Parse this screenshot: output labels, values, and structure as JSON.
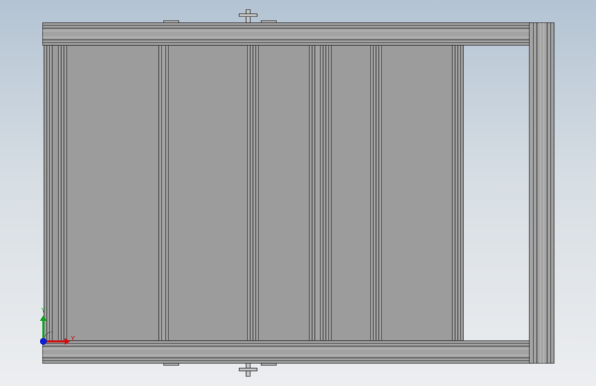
{
  "viewport": {
    "background_top": "#b3c3d3",
    "background_bottom": "#eceef0"
  },
  "model": {
    "panel_fill": "#9c9c9c",
    "frame_fill": "#a2a2a2",
    "edge_color": "#1a1a1a",
    "highlight": "#c9c9c9",
    "hardware_fill": "#c7c7c7"
  },
  "triad": {
    "y_label": "Y",
    "x_label": "Y",
    "x_color": "#d01010",
    "y_color": "#10a020",
    "z_color": "#1020d0"
  }
}
